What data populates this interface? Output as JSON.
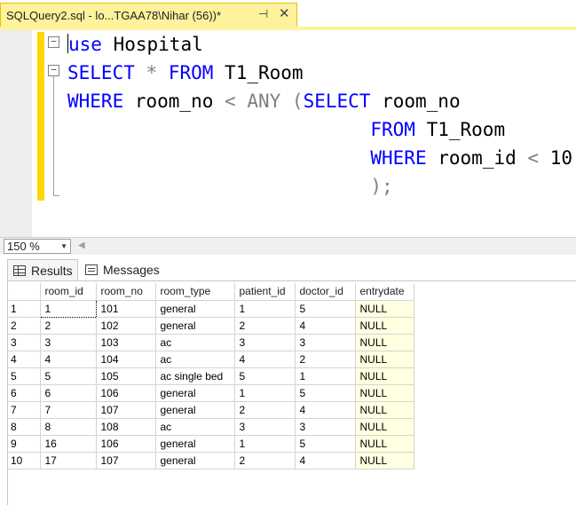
{
  "tab": {
    "title": "SQLQuery2.sql - lo...TGAA78\\Nihar (56))*",
    "pin_icon": "pin-icon",
    "close_icon": "close-icon"
  },
  "editor": {
    "lines": [
      {
        "tokens": [
          {
            "t": "use",
            "c": "kw"
          },
          {
            "t": " ",
            "c": "id"
          },
          {
            "t": "Hospital",
            "c": "id"
          }
        ]
      },
      {
        "tokens": [
          {
            "t": "SELECT",
            "c": "kw"
          },
          {
            "t": " ",
            "c": "id"
          },
          {
            "t": "*",
            "c": "op"
          },
          {
            "t": " ",
            "c": "id"
          },
          {
            "t": "FROM",
            "c": "kw"
          },
          {
            "t": " T1_Room",
            "c": "id"
          }
        ]
      },
      {
        "tokens": [
          {
            "t": "WHERE",
            "c": "kw"
          },
          {
            "t": " room_no ",
            "c": "id"
          },
          {
            "t": "<",
            "c": "op"
          },
          {
            "t": " ",
            "c": "id"
          },
          {
            "t": "ANY",
            "c": "op"
          },
          {
            "t": " ",
            "c": "id"
          },
          {
            "t": "(",
            "c": "op"
          },
          {
            "t": "SELECT",
            "c": "kw"
          },
          {
            "t": " room_no",
            "c": "id"
          }
        ]
      },
      {
        "tokens": [
          {
            "t": "                           ",
            "c": "id"
          },
          {
            "t": "FROM",
            "c": "kw"
          },
          {
            "t": " T1_Room",
            "c": "id"
          }
        ]
      },
      {
        "tokens": [
          {
            "t": "                           ",
            "c": "id"
          },
          {
            "t": "WHERE",
            "c": "kw"
          },
          {
            "t": " room_id ",
            "c": "id"
          },
          {
            "t": "<",
            "c": "op"
          },
          {
            "t": " 10",
            "c": "num"
          }
        ]
      },
      {
        "tokens": [
          {
            "t": "                           ",
            "c": "id"
          },
          {
            "t": ");",
            "c": "op"
          }
        ]
      }
    ]
  },
  "zoom": {
    "value": "150 %"
  },
  "results_tabs": {
    "results_label": "Results",
    "messages_label": "Messages"
  },
  "grid": {
    "columns": [
      "room_id",
      "room_no",
      "room_type",
      "patient_id",
      "doctor_id",
      "entrydate"
    ],
    "rows": [
      [
        "1",
        "1",
        "101",
        "general",
        "1",
        "5",
        "NULL"
      ],
      [
        "2",
        "2",
        "102",
        "general",
        "2",
        "4",
        "NULL"
      ],
      [
        "3",
        "3",
        "103",
        "ac",
        "3",
        "3",
        "NULL"
      ],
      [
        "4",
        "4",
        "104",
        "ac",
        "4",
        "2",
        "NULL"
      ],
      [
        "5",
        "5",
        "105",
        "ac single bed",
        "5",
        "1",
        "NULL"
      ],
      [
        "6",
        "6",
        "106",
        "general",
        "1",
        "5",
        "NULL"
      ],
      [
        "7",
        "7",
        "107",
        "general",
        "2",
        "4",
        "NULL"
      ],
      [
        "8",
        "8",
        "108",
        "ac",
        "3",
        "3",
        "NULL"
      ],
      [
        "9",
        "16",
        "106",
        "general",
        "1",
        "5",
        "NULL"
      ],
      [
        "10",
        "17",
        "107",
        "general",
        "2",
        "4",
        "NULL"
      ]
    ]
  },
  "colors": {
    "tab_bg": "#fff29d",
    "keyword": "#0000ff",
    "operator": "#808080",
    "change_bar": "#ffd700",
    "null_cell": "#ffffe1"
  }
}
